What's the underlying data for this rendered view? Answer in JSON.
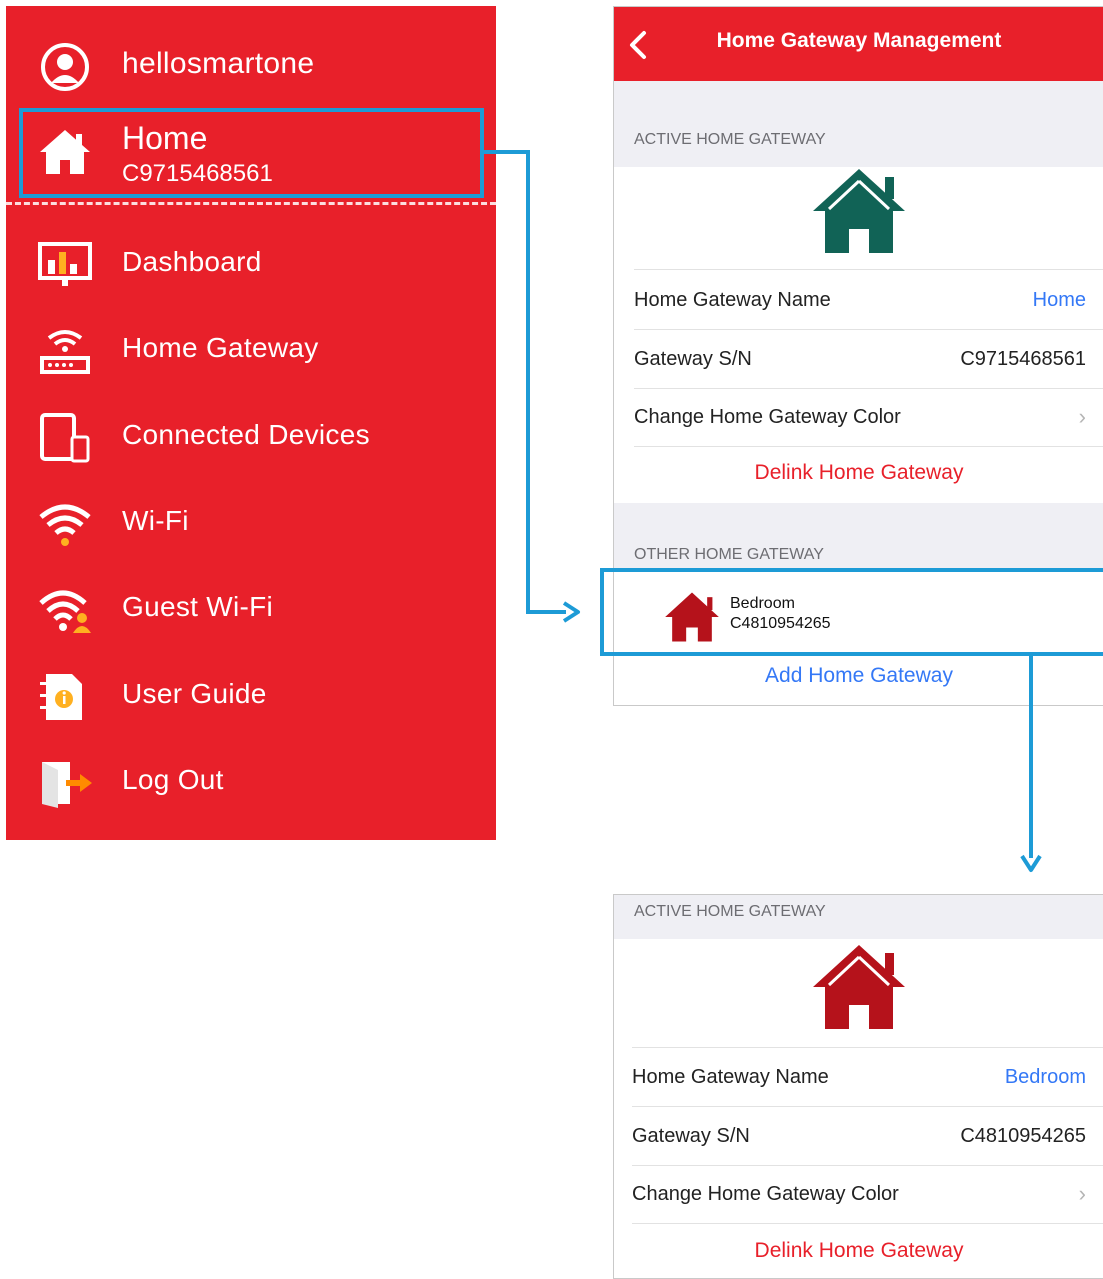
{
  "menu": {
    "username": "hellosmartone",
    "home": {
      "title": "Home",
      "serial": "C9715468561"
    },
    "items": [
      {
        "label": "Dashboard",
        "icon": "dashboard-icon"
      },
      {
        "label": "Home Gateway",
        "icon": "router-icon"
      },
      {
        "label": "Connected Devices",
        "icon": "devices-icon"
      },
      {
        "label": "Wi-Fi",
        "icon": "wifi-icon"
      },
      {
        "label": "Guest Wi-Fi",
        "icon": "guest-wifi-icon"
      },
      {
        "label": "User Guide",
        "icon": "user-guide-icon"
      },
      {
        "label": "Log Out",
        "icon": "logout-icon"
      }
    ]
  },
  "screen1": {
    "title": "Home Gateway Management",
    "active_header": "ACTIVE HOME GATEWAY",
    "house_color": "#116356",
    "name_label": "Home Gateway Name",
    "name_value": "Home",
    "sn_label": "Gateway S/N",
    "sn_value": "C9715468561",
    "color_label": "Change Home Gateway Color",
    "delink": "Delink Home Gateway",
    "other_header": "OTHER HOME GATEWAY",
    "other": {
      "name": "Bedroom",
      "serial": "C4810954265",
      "color": "#b5121b"
    },
    "add": "Add Home Gateway"
  },
  "screen2": {
    "active_header": "ACTIVE HOME GATEWAY",
    "house_color": "#b5121b",
    "name_label": "Home Gateway Name",
    "name_value": "Bedroom",
    "sn_label": "Gateway S/N",
    "sn_value": "C4810954265",
    "color_label": "Change Home Gateway Color",
    "delink": "Delink Home Gateway"
  },
  "colors": {
    "brand_red": "#e8202a",
    "callout_blue": "#1d9bd6",
    "link_blue": "#3478f6"
  }
}
